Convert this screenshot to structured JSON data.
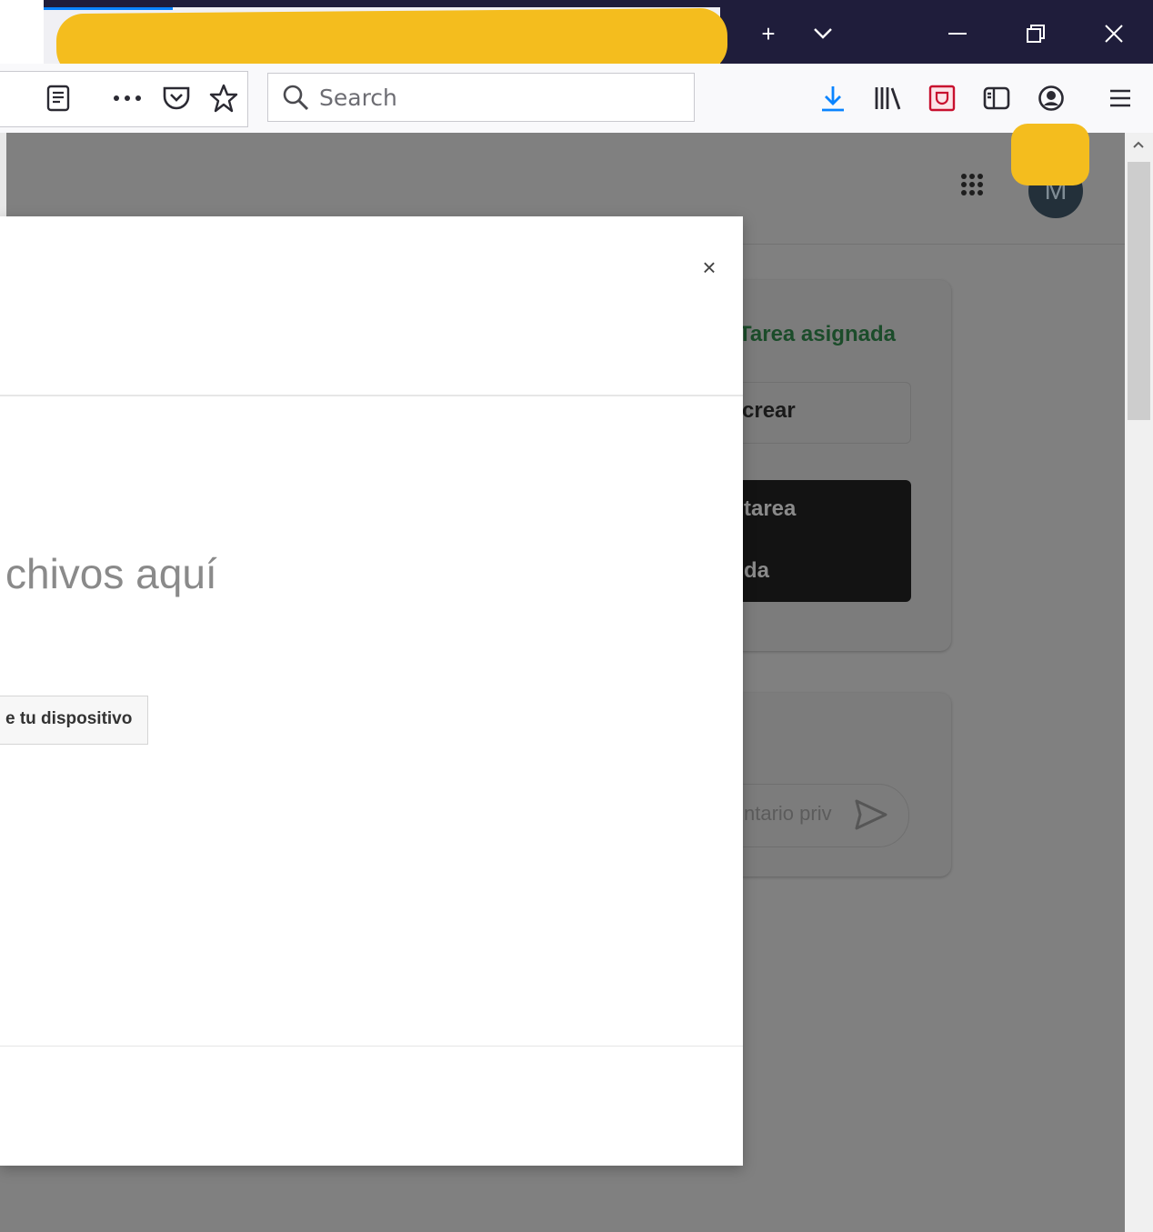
{
  "browser": {
    "search_placeholder": "Search",
    "window_buttons": {
      "minimize": "–",
      "restore": "❐",
      "close": "✕"
    },
    "new_tab": "+",
    "tab_list": "⌄"
  },
  "page": {
    "avatar_initial": "M",
    "assignment_status": "Tarea asignada",
    "create_label": "crear",
    "dark_button_line1": "tarea",
    "dark_button_line2": "da",
    "comment_placeholder": "ntario priv"
  },
  "dialog": {
    "close_label": "×",
    "drop_text": "chivos aquí",
    "device_button_label": "e tu dispositivo"
  },
  "colors": {
    "titlebar": "#1f1d3b",
    "accent_blue": "#0a84ff",
    "redaction": "#f4bd1e",
    "status_green": "#1b4c2a"
  }
}
